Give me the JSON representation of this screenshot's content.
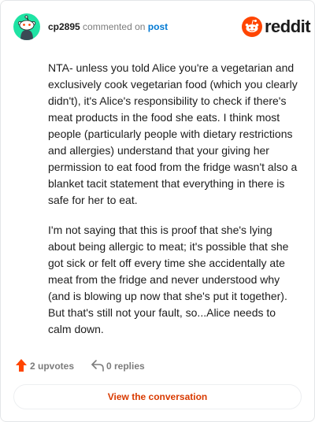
{
  "colors": {
    "avatar_bg": "#1fe3a4",
    "link_blue": "#0079d3",
    "reddit_orange": "#ff4500",
    "cta_text": "#d93a00",
    "muted": "#7c7c7c"
  },
  "header": {
    "username": "cp2895",
    "action": "commented on",
    "post_link": "post",
    "brand": "reddit",
    "avatar_icon": "snoo-avatar-icon",
    "brand_icon": "reddit-logo-icon"
  },
  "comment": {
    "paragraphs": [
      "NTA- unless you told Alice you're a vegetarian and exclusively cook vegetarian food (which you clearly didn't), it's Alice's responsibility to check if there's meat products in the food she eats. I think most people (particularly people with dietary restrictions and allergies) understand that your giving her permission to eat food from the fridge wasn't also a blanket tacit statement that everything in there is safe for her to eat.",
      "I'm not saying that this is proof that she's lying about being allergic to meat; it's possible that she got sick or felt off every time she accidentally ate meat from the fridge and never understood why (and is blowing up now that she's put it together). But that's still not your fault, so...Alice needs to calm down."
    ]
  },
  "footer": {
    "upvotes": "2 upvotes",
    "replies": "0 replies",
    "upvote_icon": "upvote-arrow-icon",
    "reply_icon": "reply-arrow-icon"
  },
  "cta": {
    "label": "View the conversation"
  }
}
